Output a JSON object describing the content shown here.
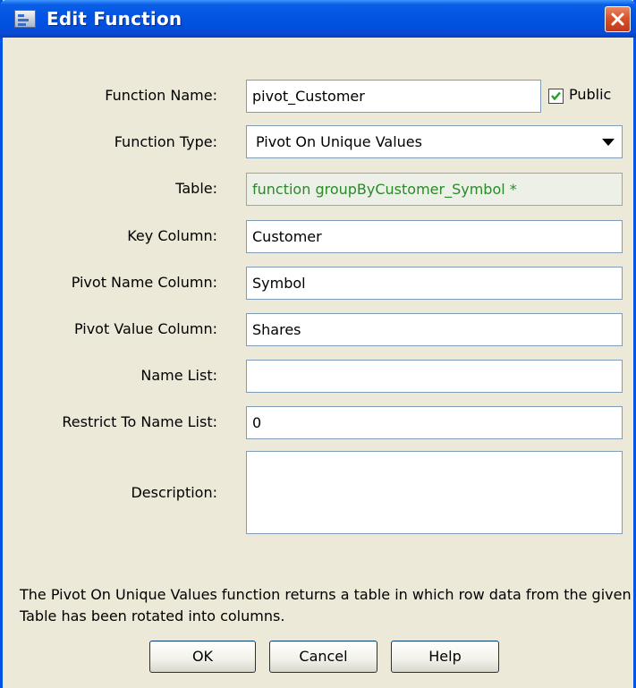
{
  "window": {
    "title": "Edit Function"
  },
  "form": {
    "function_name": {
      "label": "Function Name:",
      "value": "pivot_Customer"
    },
    "public": {
      "label": "Public",
      "checked": true
    },
    "function_type": {
      "label": "Function Type:",
      "value": "Pivot On Unique Values"
    },
    "table": {
      "label": "Table:",
      "value": "function groupByCustomer_Symbol *"
    },
    "key_column": {
      "label": "Key Column:",
      "value": "Customer"
    },
    "pivot_name_column": {
      "label": "Pivot Name Column:",
      "value": "Symbol"
    },
    "pivot_value_column": {
      "label": "Pivot Value Column:",
      "value": "Shares"
    },
    "name_list": {
      "label": "Name List:",
      "value": ""
    },
    "restrict_to_name_list": {
      "label": "Restrict To Name List:",
      "value": "0"
    },
    "description": {
      "label": "Description:",
      "value": ""
    }
  },
  "help_text": "The Pivot On Unique Values function returns a table in which row data from the given Table has been rotated into columns.",
  "buttons": {
    "ok": "OK",
    "cancel": "Cancel",
    "help": "Help"
  },
  "colors": {
    "titlebar": "#0554e3",
    "dialog_bg": "#ece9d8",
    "readonly_text": "#2a8a2a",
    "close_button": "#d8522a"
  },
  "icons": {
    "app": "window-app-icon",
    "close": "close-icon",
    "dropdown": "chevron-down-icon",
    "check": "check-icon"
  }
}
